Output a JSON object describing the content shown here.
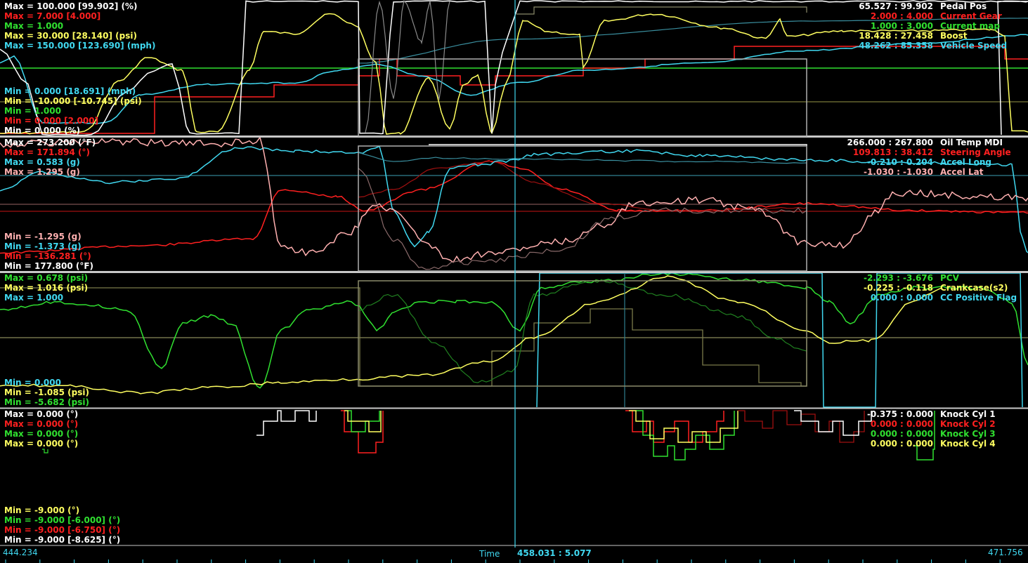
{
  "colors": {
    "white": "#ffffff",
    "red": "#ff2020",
    "green": "#30e030",
    "yellow": "#ffff60",
    "cyan": "#40d8f0",
    "pink": "#ffb0b0",
    "gray": "#b0b0b0",
    "olive": "#a0a060",
    "darkgreen": "#208020",
    "darkred": "#a01010",
    "axis": "#40d8f0"
  },
  "panels": [
    {
      "id": "panel-1",
      "max_labels": [
        {
          "text": "Max = 100.000 [99.902] (%)",
          "color": "white"
        },
        {
          "text": "Max = 7.000 [4.000]",
          "color": "red"
        },
        {
          "text": "Max = 1.000",
          "color": "green"
        },
        {
          "text": "Max = 30.000 [28.140] (psi)",
          "color": "yellow"
        },
        {
          "text": "Max = 150.000 [123.690] (mph)",
          "color": "cyan"
        }
      ],
      "min_labels": [
        {
          "text": "Min = 0.000 [18.691] (mph)",
          "color": "cyan"
        },
        {
          "text": "Min = -10.000 [-10.745] (psi)",
          "color": "yellow"
        },
        {
          "text": "Min = 1.000",
          "color": "green"
        },
        {
          "text": "Min = 0.000 [2.000]",
          "color": "red"
        },
        {
          "text": "Min = 0.000 (%)",
          "color": "white"
        }
      ],
      "legend": [
        {
          "values": "65.527 : 99.902",
          "name": "Pedal Pos",
          "color": "white"
        },
        {
          "values": "2.000 : 4.000",
          "name": "Current Gear",
          "color": "red"
        },
        {
          "values": "1.000 : 3.000",
          "name": "Current map",
          "color": "green"
        },
        {
          "values": "18.428 : 27.458",
          "name": "Boost",
          "color": "yellow"
        },
        {
          "values": "48.262 : 85.358",
          "name": "Vehicle Speed",
          "color": "cyan"
        }
      ]
    },
    {
      "id": "panel-2",
      "max_labels": [
        {
          "text": "Max = 273.200 (°F)",
          "color": "white"
        },
        {
          "text": "Max = 171.894 (°)",
          "color": "red"
        },
        {
          "text": "Max = 0.583 (g)",
          "color": "cyan"
        },
        {
          "text": "Max = 1.295 (g)",
          "color": "pink"
        }
      ],
      "min_labels": [
        {
          "text": "Min = -1.295 (g)",
          "color": "pink"
        },
        {
          "text": "Min = -1.373 (g)",
          "color": "cyan"
        },
        {
          "text": "Min = -136.281 (°)",
          "color": "red"
        },
        {
          "text": "Min = 177.800 (°F)",
          "color": "white"
        }
      ],
      "legend": [
        {
          "values": "266.000 : 267.800",
          "name": "Oil Temp MDI",
          "color": "white"
        },
        {
          "values": "109.813 : 38.412",
          "name": "Steering Angle",
          "color": "red"
        },
        {
          "values": "-0.210 : 0.204",
          "name": "Accel Long",
          "color": "cyan"
        },
        {
          "values": "-1.030 : -1.030",
          "name": "Accel Lat",
          "color": "pink"
        }
      ]
    },
    {
      "id": "panel-3",
      "max_labels": [
        {
          "text": "Max = 0.678 (psi)",
          "color": "green"
        },
        {
          "text": "Max = 1.016 (psi)",
          "color": "yellow"
        },
        {
          "text": "Max = 1.000",
          "color": "cyan"
        }
      ],
      "min_labels": [
        {
          "text": "Min = 0.000",
          "color": "cyan"
        },
        {
          "text": "Min = -1.085 (psi)",
          "color": "yellow"
        },
        {
          "text": "Min = -5.682 (psi)",
          "color": "green"
        }
      ],
      "legend": [
        {
          "values": "-2.293 : -3.676",
          "name": "PCV",
          "color": "green"
        },
        {
          "values": "-0.225 : -0.118",
          "name": "Crankcase(s2)",
          "color": "yellow"
        },
        {
          "values": "0.000 : 0.000",
          "name": "CC Positive Flag",
          "color": "cyan"
        }
      ]
    },
    {
      "id": "panel-4",
      "max_labels": [
        {
          "text": "Max = 0.000 (°)",
          "color": "white"
        },
        {
          "text": "Max = 0.000 (°)",
          "color": "red"
        },
        {
          "text": "Max = 0.000 (°)",
          "color": "green"
        },
        {
          "text": "Max = 0.000 (°)",
          "color": "yellow"
        }
      ],
      "min_labels": [
        {
          "text": "Min = -9.000 (°)",
          "color": "yellow"
        },
        {
          "text": "Min = -9.000 [-6.000] (°)",
          "color": "green"
        },
        {
          "text": "Min = -9.000 [-6.750] (°)",
          "color": "red"
        },
        {
          "text": "Min = -9.000 [-8.625] (°)",
          "color": "white"
        }
      ],
      "legend": [
        {
          "values": "-0.375 : 0.000",
          "name": "Knock Cyl 1",
          "color": "white"
        },
        {
          "values": "0.000 : 0.000",
          "name": "Knock Cyl 2",
          "color": "red"
        },
        {
          "values": "0.000 : 0.000",
          "name": "Knock Cyl 3",
          "color": "green"
        },
        {
          "values": "0.000 : 0.000",
          "name": "Knock Cyl 4",
          "color": "yellow"
        }
      ]
    }
  ],
  "time_axis": {
    "start": "444.234",
    "end": "471.756",
    "label": "Time",
    "cursor": "458.031 : 5.077"
  }
}
